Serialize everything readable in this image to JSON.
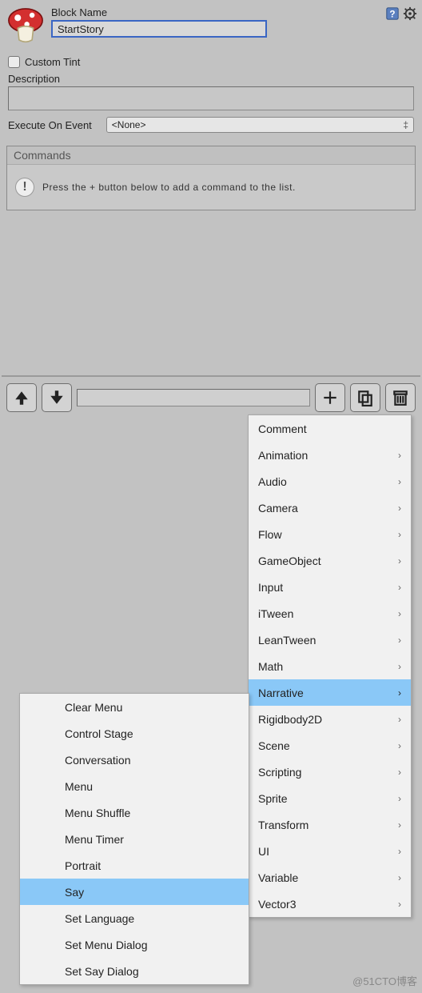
{
  "header": {
    "block_name_label": "Block Name",
    "block_name_value": "StartStory"
  },
  "properties": {
    "custom_tint_label": "Custom Tint",
    "description_label": "Description",
    "description_value": "",
    "execute_label": "Execute On Event",
    "execute_value": "<None>"
  },
  "commands": {
    "title": "Commands",
    "empty_text": "Press the + button below to add a command to the list."
  },
  "main_menu": {
    "items": [
      {
        "label": "Comment",
        "sub": false,
        "hl": false
      },
      {
        "label": "Animation",
        "sub": true,
        "hl": false
      },
      {
        "label": "Audio",
        "sub": true,
        "hl": false
      },
      {
        "label": "Camera",
        "sub": true,
        "hl": false
      },
      {
        "label": "Flow",
        "sub": true,
        "hl": false
      },
      {
        "label": "GameObject",
        "sub": true,
        "hl": false
      },
      {
        "label": "Input",
        "sub": true,
        "hl": false
      },
      {
        "label": "iTween",
        "sub": true,
        "hl": false
      },
      {
        "label": "LeanTween",
        "sub": true,
        "hl": false
      },
      {
        "label": "Math",
        "sub": true,
        "hl": false
      },
      {
        "label": "Narrative",
        "sub": true,
        "hl": true
      },
      {
        "label": "Rigidbody2D",
        "sub": true,
        "hl": false
      },
      {
        "label": "Scene",
        "sub": true,
        "hl": false
      },
      {
        "label": "Scripting",
        "sub": true,
        "hl": false
      },
      {
        "label": "Sprite",
        "sub": true,
        "hl": false
      },
      {
        "label": "Transform",
        "sub": true,
        "hl": false
      },
      {
        "label": "UI",
        "sub": true,
        "hl": false
      },
      {
        "label": "Variable",
        "sub": true,
        "hl": false
      },
      {
        "label": "Vector3",
        "sub": true,
        "hl": false
      }
    ]
  },
  "sub_menu": {
    "items": [
      {
        "label": "Clear Menu",
        "hl": false
      },
      {
        "label": "Control Stage",
        "hl": false
      },
      {
        "label": "Conversation",
        "hl": false
      },
      {
        "label": "Menu",
        "hl": false
      },
      {
        "label": "Menu Shuffle",
        "hl": false
      },
      {
        "label": "Menu Timer",
        "hl": false
      },
      {
        "label": "Portrait",
        "hl": false
      },
      {
        "label": "Say",
        "hl": true
      },
      {
        "label": "Set Language",
        "hl": false
      },
      {
        "label": "Set Menu Dialog",
        "hl": false
      },
      {
        "label": "Set Say Dialog",
        "hl": false
      }
    ]
  },
  "watermark": "@51CTO博客"
}
